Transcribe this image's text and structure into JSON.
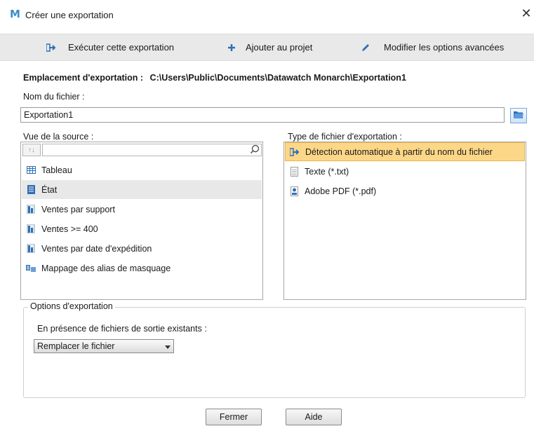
{
  "window": {
    "title": "Créer une exportation",
    "close_glyph": "✕"
  },
  "toolbar": {
    "run_label": "Exécuter cette exportation",
    "add_label": "Ajouter au projet",
    "advanced_label": "Modifier les options avancées"
  },
  "location": {
    "label": "Emplacement d'exportation :",
    "path": "C:\\Users\\Public\\Documents\\Datawatch Monarch\\Exportation1"
  },
  "filename": {
    "label": "Nom du fichier :",
    "value": "Exportation1"
  },
  "source": {
    "label": "Vue de la source :",
    "search_value": "",
    "items": [
      {
        "label": "Tableau",
        "icon": "table-icon"
      },
      {
        "label": "État",
        "icon": "report-icon",
        "selected": true
      },
      {
        "label": "Ventes par support",
        "icon": "summary-icon"
      },
      {
        "label": "Ventes >= 400",
        "icon": "summary-icon"
      },
      {
        "label": "Ventes par date d'expédition",
        "icon": "summary-icon"
      },
      {
        "label": "Mappage des alias de masquage",
        "icon": "alias-map-icon"
      }
    ]
  },
  "filetype": {
    "label": "Type de fichier d'exportation :",
    "items": [
      {
        "label": "Détection automatique à partir du nom du fichier",
        "icon": "auto-detect-icon",
        "selected": true
      },
      {
        "label": "Texte (*.txt)",
        "icon": "text-file-icon"
      },
      {
        "label": "Adobe PDF (*.pdf)",
        "icon": "pdf-file-icon"
      }
    ]
  },
  "options": {
    "group_title": "Options d'exportation",
    "existing_label": "En présence de fichiers de sortie existants :",
    "existing_value": "Remplacer le fichier"
  },
  "buttons": {
    "close_label": "Fermer",
    "help_label": "Aide"
  },
  "colors": {
    "accent": "#3a8fc9",
    "selection": "#fcd787",
    "toolbar_bg": "#e9e9e9"
  }
}
